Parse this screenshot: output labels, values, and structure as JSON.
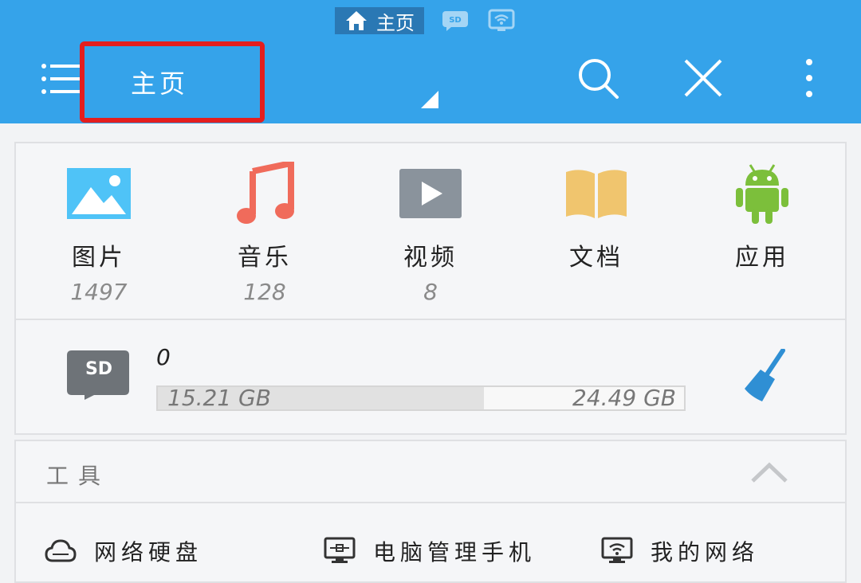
{
  "tabs": {
    "active_label": "主页"
  },
  "header": {
    "title": "主页"
  },
  "categories": [
    {
      "label": "图片",
      "count": "1497",
      "icon": "image-icon"
    },
    {
      "label": "音乐",
      "count": "128",
      "icon": "music-icon"
    },
    {
      "label": "视频",
      "count": "8",
      "icon": "video-icon"
    },
    {
      "label": "文档",
      "count": "",
      "icon": "document-icon"
    },
    {
      "label": "应用",
      "count": "",
      "icon": "android-icon"
    }
  ],
  "storage": {
    "name": "0",
    "used": "15.21 GB",
    "total": "24.49 GB",
    "used_fraction": 0.62
  },
  "tools": {
    "title": "工具",
    "items": [
      {
        "label": "网络硬盘",
        "icon": "cloud-icon"
      },
      {
        "label": "电脑管理手机",
        "icon": "monitor-icon"
      },
      {
        "label": "我的网络",
        "icon": "wifi-monitor-icon"
      }
    ]
  },
  "colors": {
    "app_bar": "#35a3ea",
    "highlight_box": "#e41e1e",
    "background": "#f2f3f5"
  }
}
